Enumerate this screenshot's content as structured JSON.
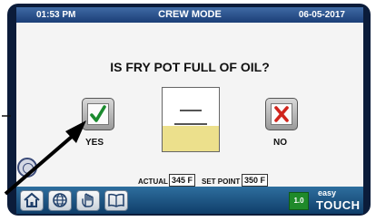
{
  "header": {
    "time": "01:53 PM",
    "title": "CREW MODE",
    "date": "06-05-2017"
  },
  "prompt": "IS FRY POT FULL OF OIL?",
  "choices": {
    "yes": {
      "label": "YES",
      "icon": "checkmark-icon",
      "color": "#1a8a2e"
    },
    "no": {
      "label": "NO",
      "icon": "x-icon",
      "color": "#d0241c"
    }
  },
  "fry_pot": {
    "icon": "fry-pot-icon",
    "oil_level_fraction": 0.4,
    "oil_color": "#ece08c"
  },
  "readouts": {
    "actual_label": "ACTUAL",
    "actual_value": "345 F",
    "set_point_label": "SET POINT",
    "set_point_value": "350 F"
  },
  "toolbar": {
    "buttons": [
      {
        "name": "home",
        "icon": "home-icon"
      },
      {
        "name": "language",
        "icon": "globe-icon"
      },
      {
        "name": "tap",
        "icon": "hand-icon"
      },
      {
        "name": "manual",
        "icon": "book-icon"
      }
    ],
    "version": "1.0",
    "brand_line1": "easy",
    "brand_line2": "TOUCH"
  },
  "colors": {
    "header": "#1b3e77",
    "toolbar": "#0f3e6a",
    "bezel": "#0b1c3a"
  }
}
